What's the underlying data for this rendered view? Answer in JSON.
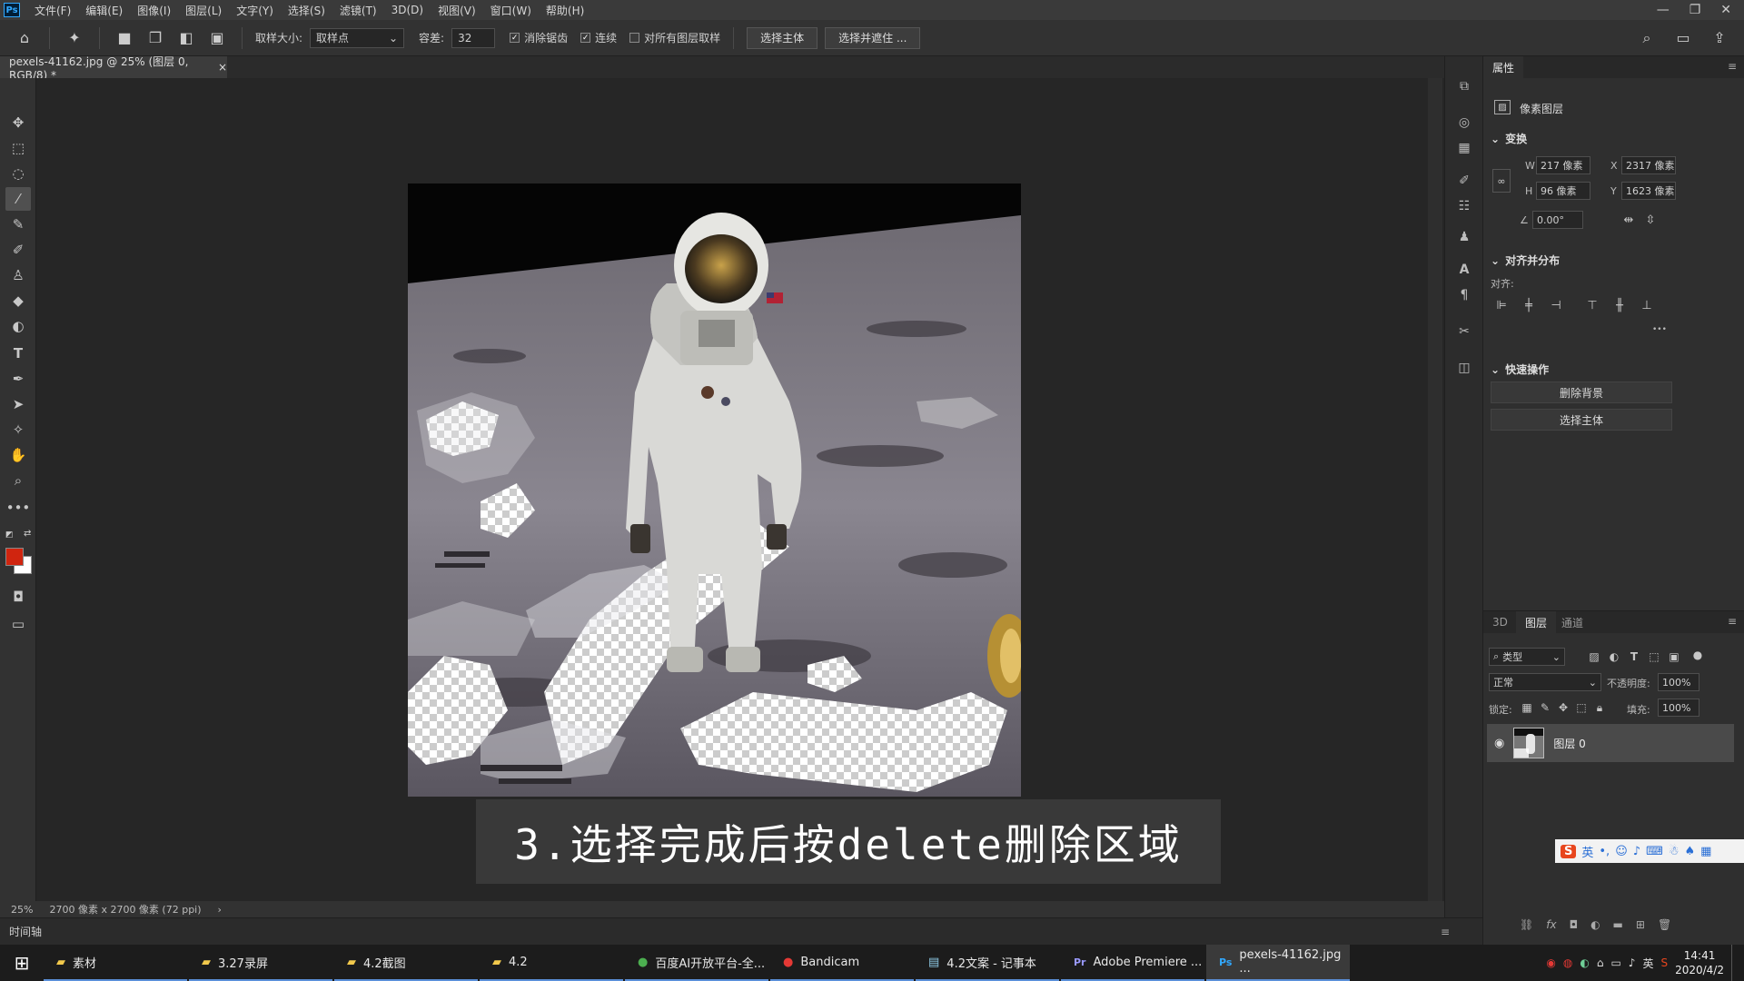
{
  "app": {
    "logo": "Ps",
    "menu": [
      "文件(F)",
      "编辑(E)",
      "图像(I)",
      "图层(L)",
      "文字(Y)",
      "选择(S)",
      "滤镜(T)",
      "3D(D)",
      "视图(V)",
      "窗口(W)",
      "帮助(H)"
    ],
    "window_buttons": [
      "—",
      "❐",
      "✕"
    ]
  },
  "options_bar": {
    "sample_size_label": "取样大小:",
    "sample_size_value": "取样点",
    "tolerance_label": "容差:",
    "tolerance_value": "32",
    "anti_alias_label": "消除锯齿",
    "anti_alias_checked": true,
    "contiguous_label": "连续",
    "contiguous_checked": true,
    "sample_all_label": "对所有图层取样",
    "sample_all_checked": false,
    "select_subject_label": "选择主体",
    "select_mask_label": "选择并遮住 ..."
  },
  "document": {
    "tab_title": "pexels-41162.jpg @ 25% (图层 0, RGB/8) *",
    "tab_close": "×"
  },
  "status_bar": {
    "zoom": "25%",
    "doc_info": "2700 像素 x 2700 像素 (72 ppi)",
    "arrow": "›"
  },
  "timeline": {
    "label": "时间轴"
  },
  "properties": {
    "tab_label": "属性",
    "layer_type": "像素图层",
    "transform_title": "变换",
    "w_label": "W",
    "w_value": "217 像素",
    "h_label": "H",
    "h_value": "96 像素",
    "x_label": "X",
    "x_value": "2317 像素",
    "y_label": "Y",
    "y_value": "1623 像素",
    "angle_value": "0.00°",
    "align_title": "对齐并分布",
    "align_label": "对齐:",
    "more": "•••",
    "quick_actions_title": "快速操作",
    "remove_bg_label": "删除背景",
    "select_subject_label": "选择主体"
  },
  "layers": {
    "tabs": [
      "3D",
      "图层",
      "通道"
    ],
    "filter_label": "类型",
    "blend_mode": "正常",
    "opacity_label": "不透明度:",
    "opacity_value": "100%",
    "lock_label": "锁定:",
    "fill_label": "填充:",
    "fill_value": "100%",
    "layer_name": "图层 0"
  },
  "caption": {
    "text": "3.选择完成后按delete删除区域"
  },
  "ime": {
    "text": "英"
  },
  "taskbar": {
    "items": [
      {
        "label": "素材",
        "icon": "folder-icon"
      },
      {
        "label": "3.27录屏",
        "icon": "folder-icon"
      },
      {
        "label": "4.2截图",
        "icon": "folder-icon"
      },
      {
        "label": "4.2",
        "icon": "folder-icon"
      },
      {
        "label": "百度AI开放平台-全...",
        "icon": "browser-icon"
      },
      {
        "label": "Bandicam",
        "icon": "record-icon"
      },
      {
        "label": "4.2文案 - 记事本",
        "icon": "notepad-icon"
      },
      {
        "label": "Adobe Premiere ...",
        "icon": "premiere-icon"
      },
      {
        "label": "pexels-41162.jpg ...",
        "icon": "photoshop-icon"
      }
    ],
    "tray_lang": "英",
    "time": "14:41",
    "date": "2020/4/2"
  },
  "colors": {
    "foreground": "#d0250f",
    "background": "#ffffff",
    "accent": "#5a8fd8"
  }
}
